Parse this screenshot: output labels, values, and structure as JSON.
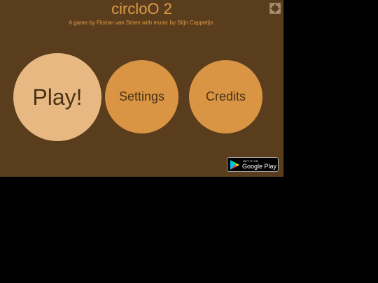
{
  "title": "circloO 2",
  "subtitle": "A game by Florian van Strien with music by Stijn Cappetijn.",
  "menu": {
    "play_label": "Play!",
    "settings_label": "Settings",
    "credits_label": "Credits"
  },
  "store_badge": {
    "small_text": "GET IT ON",
    "big_text": "Google Play"
  },
  "icons": {
    "fullscreen": "fullscreen-icon",
    "store": "google-play-icon"
  },
  "colors": {
    "background": "#5a3d1c",
    "title": "#e09a45",
    "play_button": "#e7b882",
    "menu_button": "#d99444",
    "button_text": "#4a3216"
  }
}
